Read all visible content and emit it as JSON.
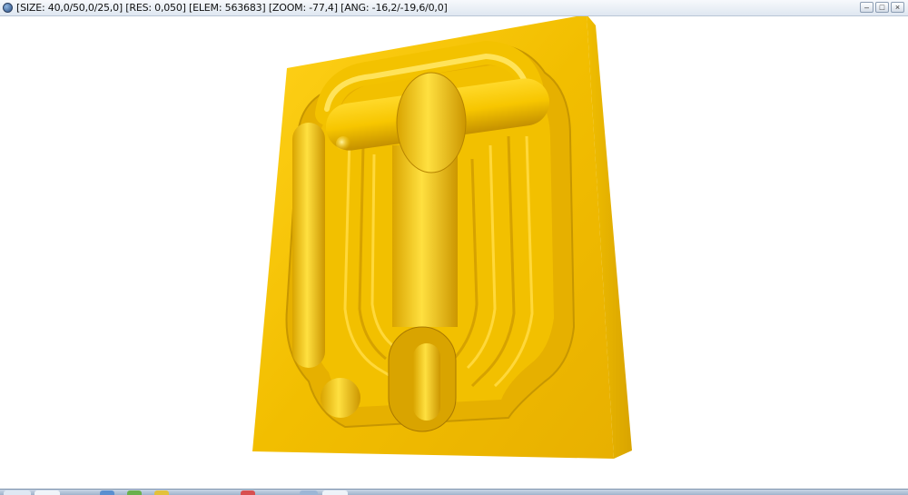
{
  "window": {
    "title": "[SIZE: 40,0/50,0/25,0] [RES: 0,050] [ELEM: 563683] [ZOOM: -77,4] [ANG: -16,2/-19,6/0,0]",
    "minimize_glyph": "–",
    "maximize_glyph": "□",
    "close_glyph": "×"
  },
  "model": {
    "color": "#f5c400",
    "shade_color": "#c99800"
  }
}
